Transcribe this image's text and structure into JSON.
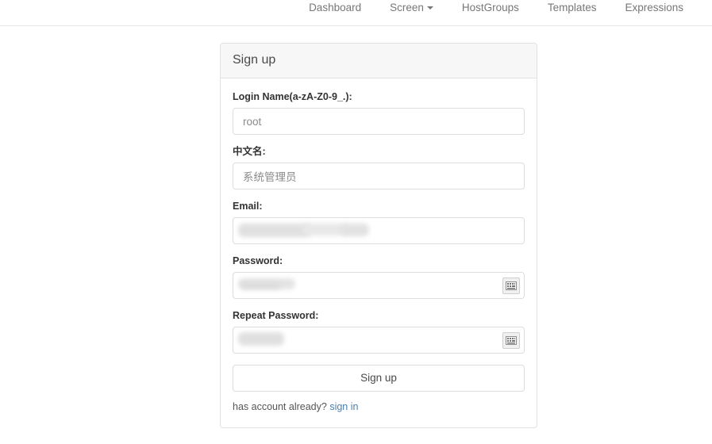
{
  "nav": {
    "items": [
      {
        "label": "Dashboard",
        "has_caret": false
      },
      {
        "label": "Screen",
        "has_caret": true
      },
      {
        "label": "HostGroups",
        "has_caret": false
      },
      {
        "label": "Templates",
        "has_caret": false
      },
      {
        "label": "Expressions",
        "has_caret": false
      }
    ]
  },
  "panel": {
    "title": "Sign up",
    "fields": [
      {
        "label": "Login Name(a-zA-Z0-9_.):",
        "value": "root",
        "placeholder": "",
        "type": "text",
        "redacted": false,
        "keyboard_icon": false
      },
      {
        "label": "中文名:",
        "value": "系统管理员",
        "placeholder": "",
        "type": "text",
        "redacted": false,
        "keyboard_icon": false
      },
      {
        "label": "Email:",
        "value": "",
        "placeholder": "",
        "type": "text",
        "redacted": true,
        "keyboard_icon": false
      },
      {
        "label": "Password:",
        "value": "",
        "placeholder": "",
        "type": "password",
        "redacted": true,
        "keyboard_icon": true
      },
      {
        "label": "Repeat Password:",
        "value": "",
        "placeholder": "",
        "type": "password",
        "redacted": true,
        "keyboard_icon": true
      }
    ],
    "submit_label": "Sign up",
    "footer_text": "has account already?",
    "footer_link": "sign in"
  },
  "icons": {
    "keyboard": "keyboard-icon",
    "caret": "chevron-down-icon"
  },
  "colors": {
    "link": "#4b7fae",
    "nav_text": "#777777",
    "panel_header_bg": "#f7f7f7",
    "border": "#e2e2e2",
    "input_border": "#dddddd",
    "redaction": "#dddddd"
  }
}
